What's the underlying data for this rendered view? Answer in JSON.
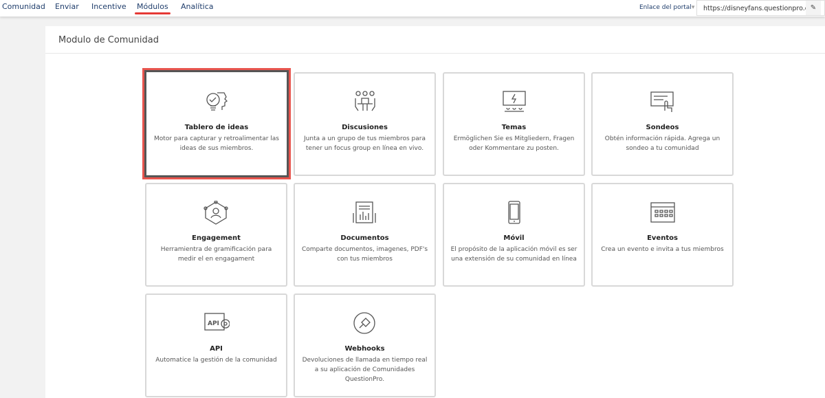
{
  "nav": {
    "items": [
      "Comunidad",
      "Enviar",
      "Incentive",
      "Módulos",
      "Analítica"
    ],
    "active": "Módulos",
    "portal_label": "Enlace del portal",
    "portal_caret": "▾",
    "portal_url": "https://disneyfans.questionpro.com"
  },
  "panel": {
    "title": "Modulo de Comunidad"
  },
  "cards": [
    {
      "title": "Tablero de ideas",
      "desc": "Motor para capturar y retroalimentar las ideas de sus miembros.",
      "icon": "lightbulb-head-icon"
    },
    {
      "title": "Discusiones",
      "desc": "Junta a un grupo de tus miembros para tener un focus group en línea en vivo.",
      "icon": "meeting-icon"
    },
    {
      "title": "Temas",
      "desc": "Ermöglichen Sie es Mitgliedern, Fragen oder Kommentare zu posten.",
      "icon": "presentation-icon"
    },
    {
      "title": "Sondeos",
      "desc": "Obtén información rápida. Agrega un sondeo a tu comunidad",
      "icon": "poll-click-icon"
    },
    {
      "title": "Engagement",
      "desc": "Herramientra de gramificación para medir el en engagament",
      "icon": "network-user-icon"
    },
    {
      "title": "Documentos",
      "desc": "Comparte documentos, imagenes, PDF's con tus miembros",
      "icon": "document-icon"
    },
    {
      "title": "Móvil",
      "desc": "El propósito de la aplicación móvil es ser una extensión de su comunidad en línea",
      "icon": "mobile-icon"
    },
    {
      "title": "Eventos",
      "desc": "Crea un evento e invita a tus miembros",
      "icon": "calendar-icon"
    },
    {
      "title": "API",
      "desc": "Automatice la gestión de la comunidad",
      "icon": "api-gear-icon",
      "icon_text": "API"
    },
    {
      "title": "Webhooks",
      "desc": "Devoluciones de llamada en tiempo real a su aplicación de Comunidades QuestionPro.",
      "icon": "plug-icon"
    }
  ]
}
